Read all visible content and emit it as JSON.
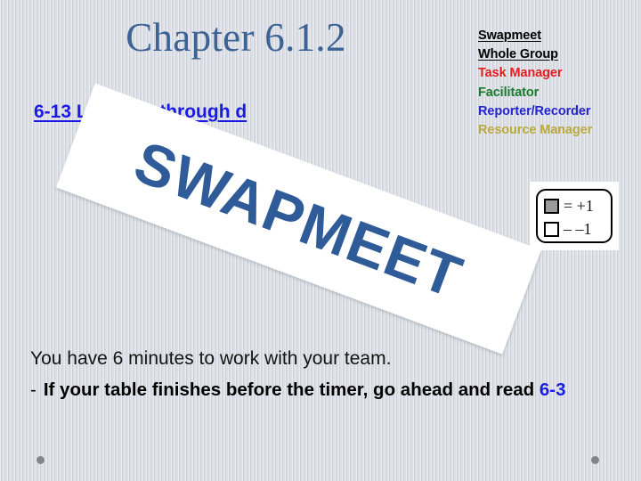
{
  "slide": {
    "title": "Chapter 6.1.2",
    "subtitle": "6-13  Letters a through d",
    "background_color": "#d6dae1",
    "title_color": "#3c6296",
    "subtitle_color": "#1b1ae2"
  },
  "roles": {
    "items": [
      {
        "label": "Swapmeet",
        "color": "#000000",
        "underline": true
      },
      {
        "label": "Whole Group",
        "color": "#000000",
        "underline": true
      },
      {
        "label": "Task Manager",
        "color": "#e02020",
        "underline": false
      },
      {
        "label": "Facilitator",
        "color": "#1a7a2e",
        "underline": false
      },
      {
        "label": "Reporter/Recorder",
        "color": "#2424cf",
        "underline": false
      },
      {
        "label": "Resource Manager",
        "color": "#b9a93f",
        "underline": false
      }
    ]
  },
  "banner": {
    "text": "SWAPMEET",
    "text_color": "#2f5c99",
    "fill_color": "#ffffff",
    "rotation_degrees": 20.5
  },
  "legend": {
    "rows": [
      {
        "swatch": "filled",
        "swatch_color": "#9a9a9a",
        "label": "= +1"
      },
      {
        "swatch": "empty",
        "swatch_color": "#ffffff",
        "label": "– –1"
      }
    ]
  },
  "body": {
    "line1": "You have 6 minutes to work with your team.",
    "bullet_dash": "-",
    "bullet_text_before": "If your table finishes before the timer, go ahead and read ",
    "bullet_reference": "6-3"
  }
}
